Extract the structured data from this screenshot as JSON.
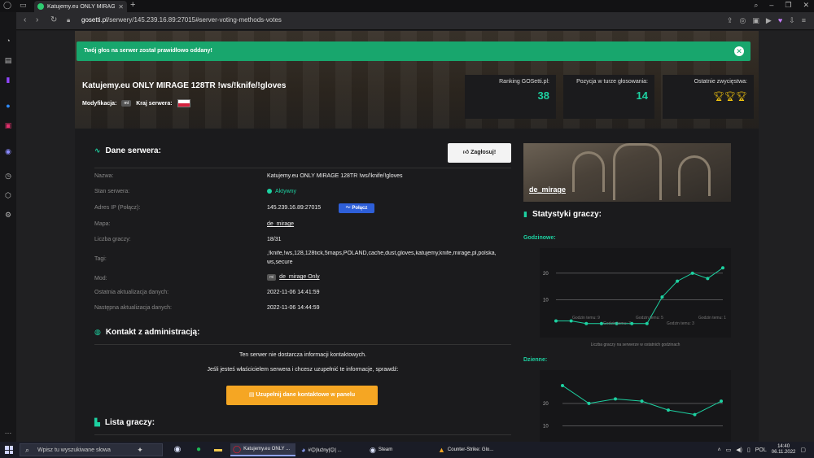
{
  "browser": {
    "tab_title": "Katujemy.eu ONLY MIRAGE",
    "url_host": "gosetti.pl",
    "url_path": "/serwery/145.239.16.89:27015#server-voting-methods-votes"
  },
  "alert": {
    "message": "Twój głos na serwer został prawidłowo oddany!"
  },
  "server": {
    "title": "Katujemy.eu ONLY MIRAGE 128TR !ws/!knife/!gloves",
    "mod_label": "Modyfikacja:",
    "mod_badge": "mi",
    "country_label": "Kraj serwera:"
  },
  "stats": {
    "ranking_label": "Ranking GOSetti.pl:",
    "ranking_value": "38",
    "position_label": "Pozycja w turze głosowania:",
    "position_value": "14",
    "wins_label": "Ostatnie zwycięstwa:",
    "trophies": [
      "trophy-icon",
      "trophy-icon",
      "trophy-icon"
    ]
  },
  "details": {
    "heading": "Dane serwera:",
    "vote_button": "Zagłosuj!",
    "connect_button": "Połącz",
    "rows": [
      {
        "label": "Nazwa:",
        "value": "Katujemy.eu ONLY MIRAGE 128TR !ws/!knife/!gloves"
      },
      {
        "label": "Stan serwera:",
        "value": "Aktywny"
      },
      {
        "label": "Adres IP (Połącz):",
        "value": "145.239.16.89:27015"
      },
      {
        "label": "Mapa:",
        "value": "de_mirage"
      },
      {
        "label": "Liczba graczy:",
        "value": "18/31"
      },
      {
        "label": "Tagi:",
        "value": ",!knife,!ws,128,128tick,5maps,POLAND,cache,dust,gloves,katujemy,knife,mirage,pl,polska,"
      },
      {
        "label": "Mod:",
        "value": "de_mirage Only"
      },
      {
        "label": "Ostatnia aktualizacja danych:",
        "value": "2022-11-06 14:41:59"
      },
      {
        "label": "Następna aktualizacja danych:",
        "value": "2022-11-06 14:44:59"
      }
    ],
    "tags_line2": "ws,secure",
    "mod_badge": "mi"
  },
  "contact": {
    "heading": "Kontakt z administracją:",
    "line1": "Ten serwer nie dostarcza informacji kontaktowych.",
    "line2": "Jeśli jesteś właścicielem serwera i chcesz uzupełnić te informacje, sprawdź:",
    "button": "Uzupełnij dane kontaktowe w panelu"
  },
  "players": {
    "heading": "Lista graczy:"
  },
  "map_card": {
    "name": "de_mirage"
  },
  "player_stats": {
    "heading": "Statystyki graczy:",
    "hourly_label": "Godzinowe:",
    "daily_label": "Dzienne:",
    "hourly_caption": "Liczba graczy na serwerze w ostatnich godzinach"
  },
  "chart_data": [
    {
      "type": "line",
      "title": "Godzinowe:",
      "x": [
        "Godzin temu: 9",
        "",
        "",
        "",
        "",
        "Godzin temu: 5",
        "",
        "",
        "",
        "Godzin temu: 1",
        ""
      ],
      "x_labels_lower": [
        "Godzin temu: 7",
        "Godzin temu: 3"
      ],
      "y": [
        2,
        2,
        1,
        1,
        1,
        1,
        1,
        11,
        17,
        20,
        18,
        22
      ],
      "yticks": [
        10,
        20
      ],
      "ylim": [
        0,
        27
      ],
      "xlabel": "Liczba graczy na serwerze w ostatnich godzinach",
      "grid": true,
      "color": "#1dd1a1"
    },
    {
      "type": "line",
      "title": "Dzienne:",
      "y": [
        28,
        20,
        22,
        21,
        17,
        15,
        21
      ],
      "yticks": [
        10,
        20
      ],
      "ylim": [
        5,
        32
      ],
      "grid": true,
      "color": "#1dd1a1"
    }
  ],
  "taskbar": {
    "search_placeholder": "Wpisz tu wyszukiwane słowa",
    "apps": [
      {
        "name": "Katujemy.eu ONLY ..."
      },
      {
        "name": "#😊|luźny|😊| ..."
      },
      {
        "name": "Steam"
      },
      {
        "name": "Counter-Strike: Glo..."
      }
    ],
    "lang": "POL",
    "time": "14:40",
    "date": "06.11.2022"
  }
}
